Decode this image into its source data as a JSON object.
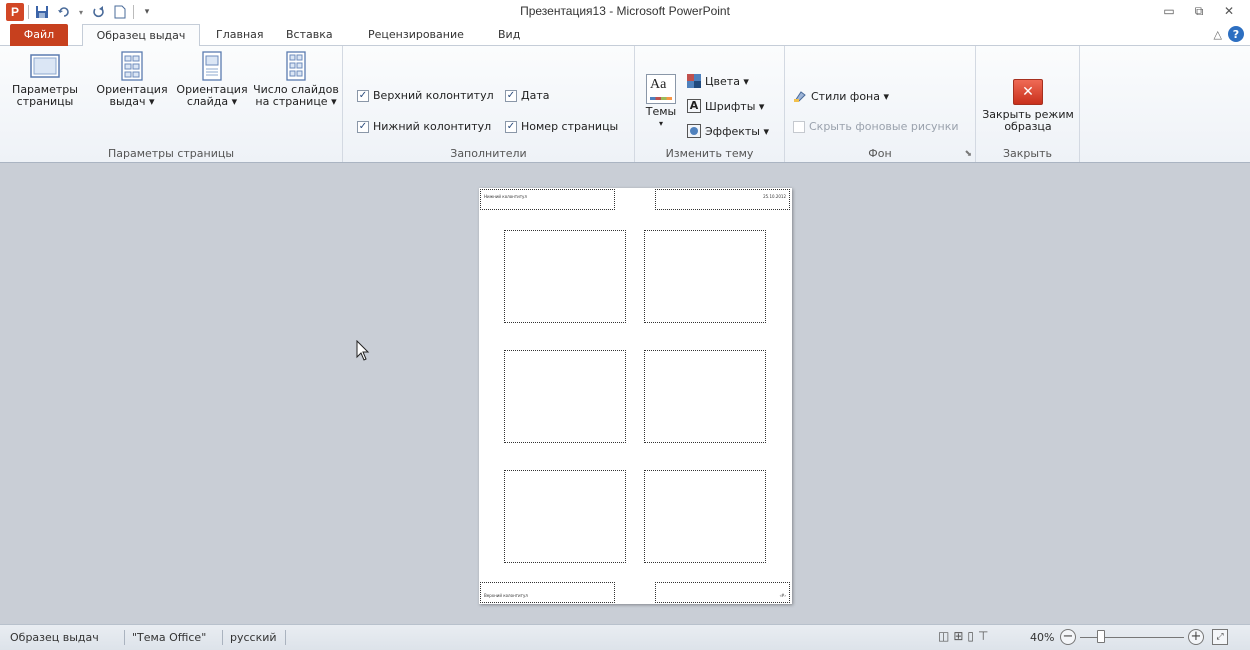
{
  "window": {
    "title": "Презентация13 - Microsoft PowerPoint",
    "app_logo": "P",
    "controls": {
      "minimize": "▭",
      "maximize": "⧉",
      "close": "✕"
    }
  },
  "tabs": {
    "file": "Файл",
    "items": [
      "Образец выдач",
      "Главная",
      "Вставка",
      "Рецензирование",
      "Вид"
    ],
    "active": "Образец выдач"
  },
  "ribbon": {
    "page_setup": {
      "label": "Параметры страницы",
      "buttons": [
        {
          "line1": "Параметры",
          "line2": "страницы"
        },
        {
          "line1": "Ориентация",
          "line2": "выдач ▾"
        },
        {
          "line1": "Ориентация",
          "line2": "слайда ▾"
        },
        {
          "line1": "Число слайдов",
          "line2": "на странице ▾"
        }
      ]
    },
    "placeholders": {
      "label": "Заполнители",
      "header": "Верхний колонтитул",
      "date": "Дата",
      "footer": "Нижний колонтитул",
      "page_number": "Номер страницы",
      "check": "✓"
    },
    "theme": {
      "label": "Изменить тему",
      "themes": "Темы",
      "themes_arrow": "▾",
      "colors": "Цвета ▾",
      "fonts": "Шрифты ▾",
      "effects": "Эффекты ▾",
      "icon_text": "Aa"
    },
    "background": {
      "label": "Фон",
      "styles": "Стили фона ▾",
      "hide": "Скрыть фоновые рисунки",
      "launcher": "⬊"
    },
    "close": {
      "label": "Закрыть",
      "line1": "Закрыть режим",
      "line2": "образца",
      "icon": "✕"
    }
  },
  "handout": {
    "header_text": "Нижний колонтитул",
    "date_text": "25.10.2012",
    "footer_text": "Верхний колонтитул",
    "page_number_text": "‹#›"
  },
  "statusbar": {
    "view": "Образец выдач",
    "theme": "\"Тема Office\"",
    "language": "русский",
    "zoom": "40%",
    "zoom_fraction": 0.4,
    "minus": "−",
    "plus": "+"
  }
}
